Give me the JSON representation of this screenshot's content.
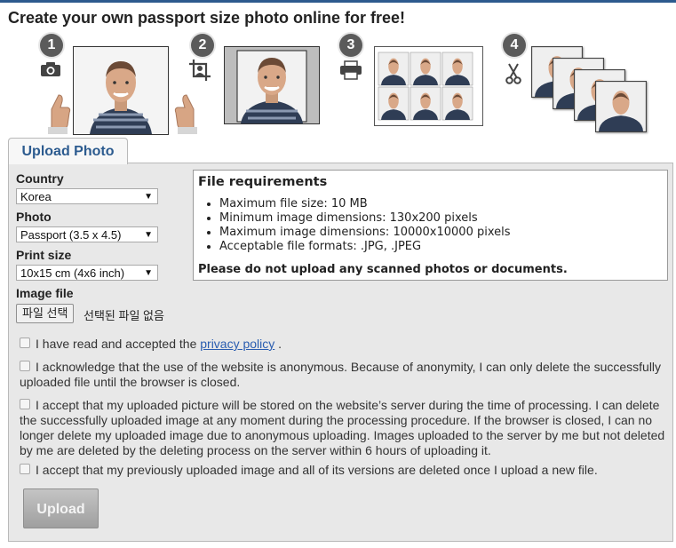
{
  "page": {
    "title": "Create your own passport size photo online for free!"
  },
  "steps": [
    {
      "number": "1",
      "icon": "camera-icon"
    },
    {
      "number": "2",
      "icon": "crop-icon"
    },
    {
      "number": "3",
      "icon": "printer-icon"
    },
    {
      "number": "4",
      "icon": "scissors-icon"
    }
  ],
  "tab": {
    "label": "Upload Photo"
  },
  "form": {
    "country_label": "Country",
    "country_value": "Korea",
    "photo_label": "Photo",
    "photo_value": "Passport (3.5 x 4.5)",
    "print_label": "Print size",
    "print_value": "10x15 cm (4x6 inch)",
    "file_label": "Image file",
    "file_button": "파일 선택",
    "file_status": "선택된 파일 없음"
  },
  "requirements": {
    "title": "File requirements",
    "items": [
      "Maximum file size: 10 MB",
      "Minimum image dimensions: 130x200 pixels",
      "Maximum image dimensions: 10000x10000 pixels",
      "Acceptable file formats: .JPG, .JPEG"
    ],
    "warning": "Please do not upload any scanned photos or documents."
  },
  "checkboxes": {
    "privacy_prefix": "I have read and accepted the",
    "privacy_link": "privacy policy",
    "privacy_suffix": ".",
    "anonymous": "I acknowledge that the use of the website is anonymous. Because of anonymity, I can only delete the successfully uploaded file until the browser is closed.",
    "storage": "I accept that my uploaded picture will be stored on the website’s server during the time of processing. I can delete the successfully uploaded image at any moment during the processing procedure. If the browser is closed, I can no longer delete my uploaded image due to anonymous uploading. Images uploaded to the server by me but not deleted by me are deleted by the deleting process on the server within 6 hours of uploading it.",
    "replace": "I accept that my previously uploaded image and all of its versions are deleted once I upload a new file."
  },
  "upload_button": "Upload",
  "colors": {
    "accent": "#2d5a8e",
    "link": "#2a5db0",
    "panel": "#e8e8e8"
  }
}
